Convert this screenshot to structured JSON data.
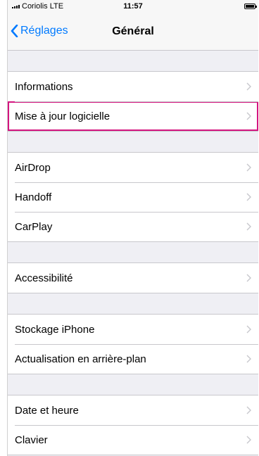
{
  "status_bar": {
    "carrier": "Coriolis  LTE",
    "time": "11:57",
    "battery_icon": "battery-full-icon"
  },
  "nav_bar": {
    "back_label": "Réglages",
    "title": "Général",
    "back_icon": "chevron-left-icon",
    "accent_color": "#007aff"
  },
  "groups": [
    {
      "items": [
        {
          "label": "Informations"
        },
        {
          "label": "Mise à jour logicielle",
          "highlighted": true
        }
      ]
    },
    {
      "items": [
        {
          "label": "AirDrop"
        },
        {
          "label": "Handoff"
        },
        {
          "label": "CarPlay"
        }
      ]
    },
    {
      "items": [
        {
          "label": "Accessibilité"
        }
      ]
    },
    {
      "items": [
        {
          "label": "Stockage iPhone"
        },
        {
          "label": "Actualisation en arrière-plan"
        }
      ]
    },
    {
      "items": [
        {
          "label": "Date et heure"
        },
        {
          "label": "Clavier"
        }
      ]
    }
  ],
  "row_icon": "chevron-right-icon",
  "highlight_color": "#d4147f"
}
